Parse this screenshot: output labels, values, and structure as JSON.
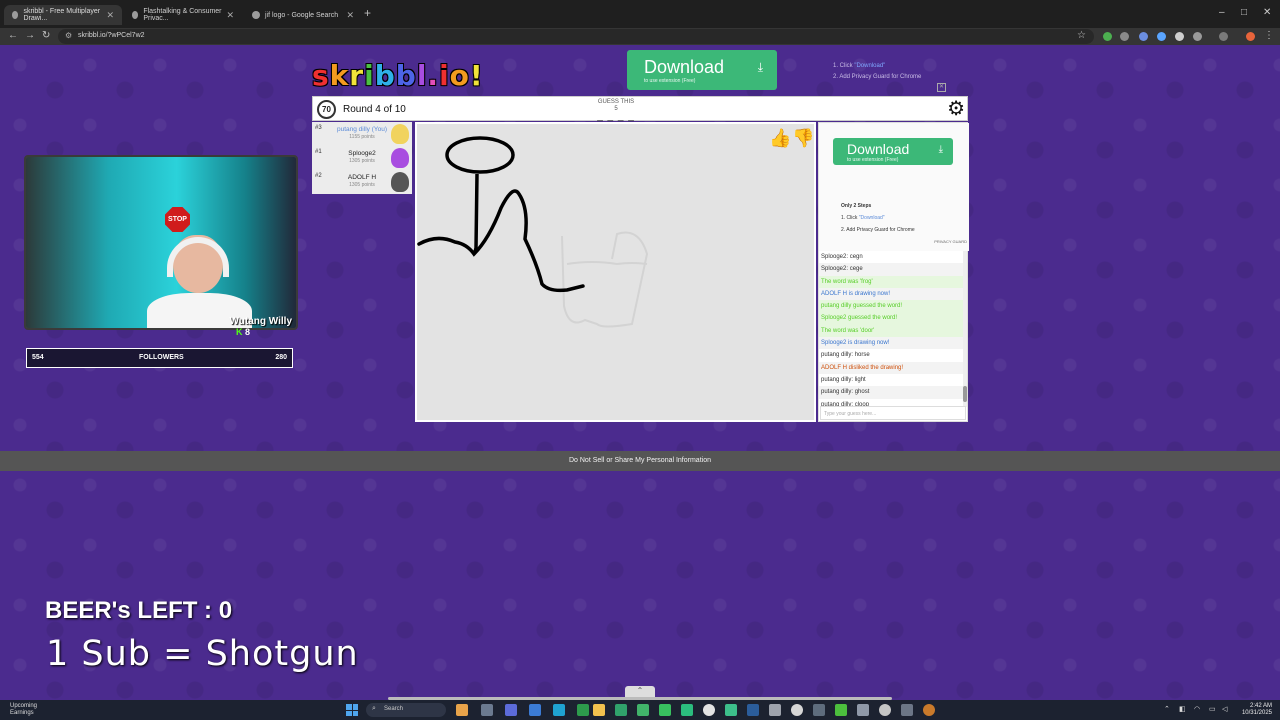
{
  "browser": {
    "tabs": [
      {
        "title": "skribbl - Free Multiplayer Drawi...",
        "active": true
      },
      {
        "title": "Flashtalking & Consumer Privac...",
        "active": false
      },
      {
        "title": "jif logo - Google Search",
        "active": false
      }
    ],
    "url": "skribbl.io/?wPCel7w2",
    "window_controls": {
      "minimize": "–",
      "maximize": "□",
      "close": "✕"
    }
  },
  "game": {
    "logo_text": "skribbl.io!",
    "logo_colors": [
      "#ef3030",
      "#f39b1f",
      "#f1e33a",
      "#4ac141",
      "#2fb1e8",
      "#4d64e7",
      "#a84de0",
      "#e24eb8",
      "#ef3030",
      "#f39b1f",
      "#f1e33a"
    ],
    "top_download": {
      "label": "Download",
      "sub": "to use extension (Free)"
    },
    "top_note": {
      "line1_prefix": "1. Click ",
      "line1_link": "\"Download\"",
      "line2": "2. Add Privacy Guard for Chrome"
    },
    "timer": "70",
    "round_label": "Round 4 of 10",
    "guess_label": "GUESS THIS",
    "guess_count": "5",
    "guess_blanks": "_ _ _ _ _",
    "players": [
      {
        "rank": "#3",
        "name": "putang dilly (You)",
        "points": "1155 points",
        "me": true,
        "avatar_color": "#f1d35e"
      },
      {
        "rank": "#1",
        "name": "Splooge2",
        "points": "1305 points",
        "me": false,
        "avatar_color": "#a84de0"
      },
      {
        "rank": "#2",
        "name": "ADOLF H",
        "points": "1305 points",
        "me": false,
        "avatar_color": "#555555"
      }
    ],
    "side_download": {
      "label": "Download",
      "sub": "to use extension (Free)"
    },
    "steps": {
      "title": "Only 2 Steps",
      "step1_prefix": "1. Click ",
      "step1_link": "\"Download\"",
      "step2": "2. Add Privacy Guard for Chrome"
    },
    "privacy_tag": "PRIVACY GUARD",
    "chat": [
      {
        "text": "Splooge2: cegn",
        "style": "normal"
      },
      {
        "text": "Splooge2: cege",
        "style": "normal"
      },
      {
        "text": "The word was 'frog'",
        "style": "sys-green"
      },
      {
        "text": "ADOLF H is drawing now!",
        "style": "sys-blue"
      },
      {
        "text": "putang dilly guessed the word!",
        "style": "sys-green"
      },
      {
        "text": "Splooge2 guessed the word!",
        "style": "sys-green"
      },
      {
        "text": "The word was 'door'",
        "style": "sys-green"
      },
      {
        "text": "Splooge2 is drawing now!",
        "style": "sys-blue"
      },
      {
        "text": "putang dilly: horse",
        "style": "normal"
      },
      {
        "text": "ADOLF H disliked the drawing!",
        "style": "sys-red"
      },
      {
        "text": "putang dilly: light",
        "style": "normal"
      },
      {
        "text": "putang dilly: ghost",
        "style": "normal"
      },
      {
        "text": "putang dilly: cloop",
        "style": "normal"
      }
    ],
    "chat_placeholder": "Type your guess here..."
  },
  "overlay": {
    "cam_name": "Wutang Willy",
    "cam_subs": "8",
    "stop_sign": "STOP",
    "followers_left": "554",
    "followers_label": "FOLLOWERS",
    "followers_right": "280",
    "beer_text": "BEER's LEFT : 0",
    "shotgun_text": "1 Sub = Shotgun"
  },
  "cookie_notice": "Do Not Sell or Share My Personal Information",
  "taskbar": {
    "weather_title": "Upcoming",
    "weather_sub": "Earnings",
    "search_label": "Search",
    "time": "2:42 AM",
    "date": "10/31/2025"
  }
}
